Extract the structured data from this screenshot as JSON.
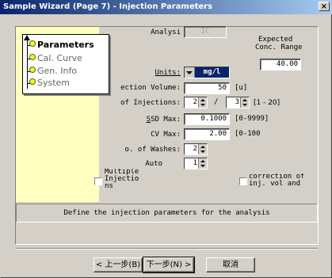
{
  "window": {
    "title": "Sample Wizard (Page 7) - Injection Parameters",
    "close_glyph": "×"
  },
  "nav": {
    "items": [
      {
        "label": "Parameters",
        "active": true
      },
      {
        "label": "Cal. Curve",
        "active": false
      },
      {
        "label": "Gen. Info",
        "active": false
      },
      {
        "label": "System",
        "active": false
      }
    ]
  },
  "form": {
    "analysis_label": "Analysi",
    "analysis_value": "IC",
    "units_label": "Units:",
    "units_value": "mg/l",
    "expected_label_1": "Expected",
    "expected_label_2": "Conc. Range",
    "expected_value": "40.00",
    "volume_label": "ection Volume:",
    "volume_value": "50",
    "volume_unit": "[u]",
    "injections_label": "of Injections:",
    "injections_min": "2",
    "injections_sep": "/",
    "injections_max": "3",
    "injections_range": "[1 - 20]",
    "sd_label": "SD Max:",
    "sd_value": "0.1000",
    "sd_range": "[0-9999]",
    "cv_label": "CV Max:",
    "cv_value": "2.00",
    "cv_range": "[0-100",
    "washes_label": "o. of Washes:",
    "washes_value": "2",
    "auto_label": "Auto",
    "auto_value": "1",
    "multiple_label": "Multiple\nInjectio\nns",
    "correction_label": "correction of\ninj. vol and"
  },
  "info_text": "Define the injection parameters for the analysis",
  "buttons": {
    "back": "< 上一步(B)",
    "next": "下一步(N) >",
    "cancel": "取消"
  }
}
